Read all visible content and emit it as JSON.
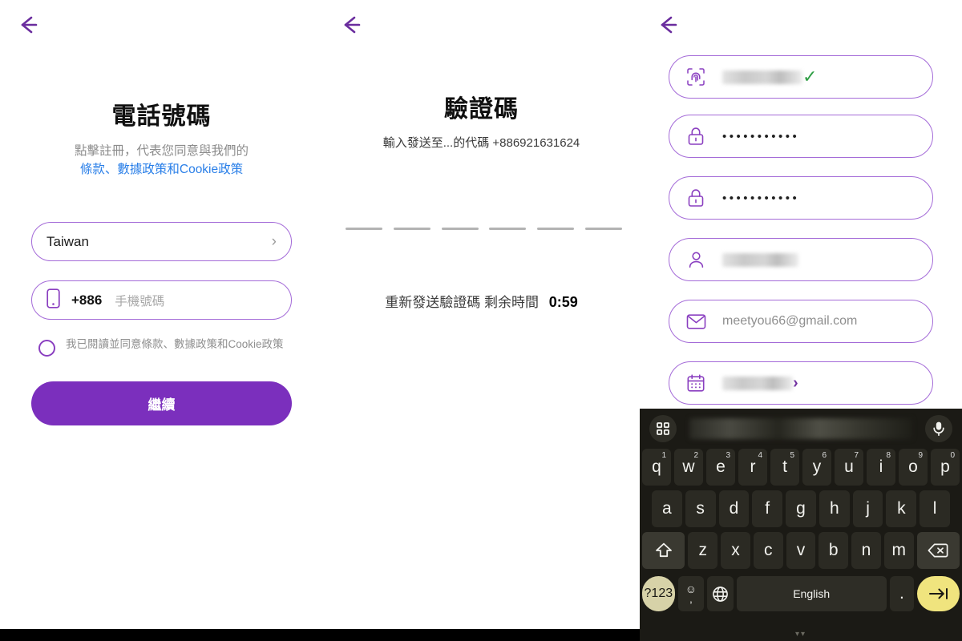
{
  "panel1": {
    "back_icon": "back-arrow-icon",
    "title": "電話號碼",
    "subtitle": "點擊註冊，代表您同意與我們的",
    "policy_link": "條款、數據政策和Cookie政策",
    "country_field": {
      "icon": "chevron-right-icon",
      "value": "Taiwan"
    },
    "phone_field": {
      "icon": "phone-icon",
      "country_code": "+886",
      "placeholder": "手機號碼"
    },
    "consent": {
      "icon": "radio-unchecked-icon",
      "text": "我已閱讀並同意條款、數據政策和Cookie政策",
      "checked": false
    },
    "continue_button": "繼續"
  },
  "panel2": {
    "back_icon": "back-arrow-icon",
    "title": "驗證碼",
    "subtitle": "輸入發送至...的代碼 +886921631624",
    "otp_slots": [
      "",
      "",
      "",
      "",
      "",
      ""
    ],
    "resend_label": "重新發送驗證碼  剩余時間",
    "timer": "0:59"
  },
  "panel3": {
    "back_icon": "back-arrow-icon",
    "fields": [
      {
        "icon": "fingerprint-icon",
        "value": "",
        "masked": true,
        "status_icon": "check-icon",
        "status_color": "#2e9e44"
      },
      {
        "icon": "lock-icon",
        "value": "•••••••••••",
        "masked": false
      },
      {
        "icon": "lock-icon",
        "value": "•••••••••••",
        "masked": false
      },
      {
        "icon": "person-icon",
        "value": "",
        "masked": true
      },
      {
        "icon": "mail-icon",
        "value": "meetyou66@gmail.com",
        "masked": false
      },
      {
        "icon": "calendar-icon",
        "value": "",
        "masked": true,
        "status_icon": "chevron-right-icon",
        "status_color": "#6d2a9e"
      }
    ],
    "keyboard": {
      "suggestion_left_icon": "grid-icon",
      "suggestion_right_icon": "microphone-icon",
      "row1": [
        {
          "key": "q",
          "sup": "1"
        },
        {
          "key": "w",
          "sup": "2"
        },
        {
          "key": "e",
          "sup": "3"
        },
        {
          "key": "r",
          "sup": "4"
        },
        {
          "key": "t",
          "sup": "5"
        },
        {
          "key": "y",
          "sup": "6"
        },
        {
          "key": "u",
          "sup": "7"
        },
        {
          "key": "i",
          "sup": "8"
        },
        {
          "key": "o",
          "sup": "9"
        },
        {
          "key": "p",
          "sup": "0"
        }
      ],
      "row2": [
        "a",
        "s",
        "d",
        "f",
        "g",
        "h",
        "j",
        "k",
        "l"
      ],
      "row3": {
        "shift_icon": "shift-icon",
        "keys": [
          "z",
          "x",
          "c",
          "v",
          "b",
          "n",
          "m"
        ],
        "backspace_icon": "backspace-icon"
      },
      "row4": {
        "symbols": "?123",
        "emoji_top": "☺",
        "emoji_bottom": ",",
        "globe_icon": "globe-icon",
        "space_label": "English",
        "period": ".",
        "enter_icon": "enter-icon"
      }
    }
  },
  "colors": {
    "accent_purple": "#7b2fbd",
    "border_purple": "#a46bd8",
    "link_blue": "#2a7fe8",
    "success_green": "#2e9e44",
    "keyboard_bg": "#1b1a15",
    "enter_yellow": "#f0e47e"
  }
}
